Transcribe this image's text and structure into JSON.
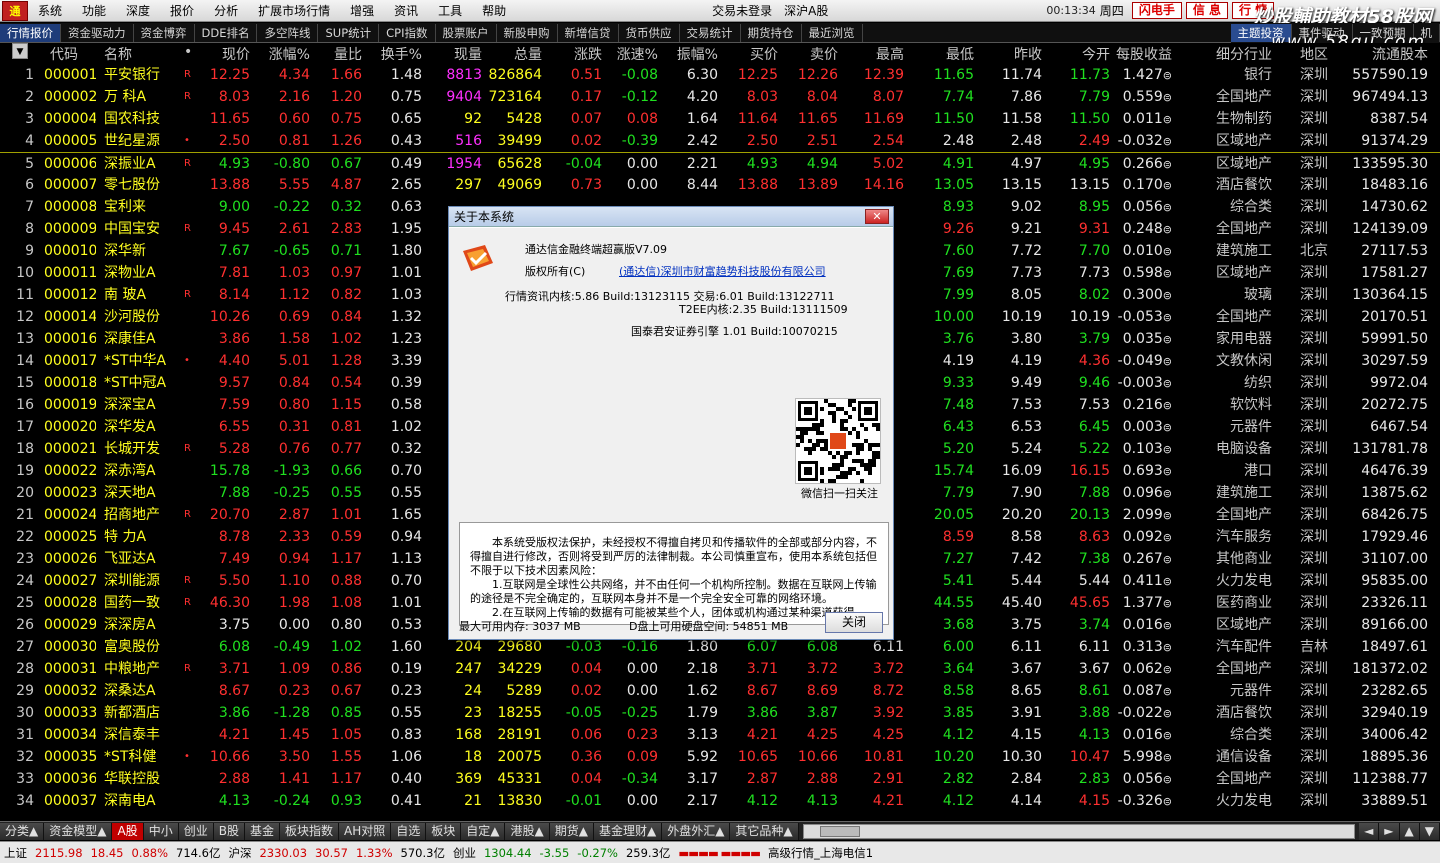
{
  "menubar": {
    "items": [
      "系统",
      "功能",
      "深度",
      "报价",
      "分析",
      "扩展市场行情",
      "增强",
      "资讯",
      "工具",
      "帮助"
    ],
    "login_status": "交易未登录",
    "market": "深沪A股",
    "clock": "00:13:34",
    "weekday": "周四",
    "buttons": [
      "闪电手",
      "信 息",
      "行 情"
    ]
  },
  "watermark": {
    "line1": "炒股輔助教材58股网",
    "line2": "www.58gu.com"
  },
  "tabs": [
    "行情报价",
    "资金驱动力",
    "资金博弈",
    "DDE排名",
    "多空阵线",
    "SUP统计",
    "CPI指数",
    "股票账户",
    "新股申购",
    "新增信贷",
    "货币供应",
    "交易统计",
    "期货持仓",
    "最近浏览"
  ],
  "tabs_right": [
    "主题投资",
    "事件驱动",
    "一致预期",
    "机"
  ],
  "columns": [
    "代码",
    "名称",
    "•",
    "现价",
    "涨幅%",
    "量比",
    "换手%",
    "现量",
    "总量",
    "涨跌",
    "涨速%",
    "振幅%",
    "买价",
    "卖价",
    "最高",
    "最低",
    "昨收",
    "今开",
    "每股收益",
    "细分行业",
    "地区",
    "流通股本"
  ],
  "rows": [
    [
      "1",
      "000001",
      "平安银行",
      "R",
      "12.25",
      "4.34",
      "1.66",
      "1.48",
      "8813",
      "826864",
      "0.51",
      "-0.08",
      "6.30",
      "12.25",
      "12.26",
      "12.39",
      "11.65",
      "11.74",
      "11.73",
      "1.427",
      "银行",
      "深圳",
      "557590.19"
    ],
    [
      "2",
      "000002",
      "万  科A",
      "R",
      "8.03",
      "2.16",
      "1.20",
      "0.75",
      "9404",
      "723164",
      "0.17",
      "-0.12",
      "4.20",
      "8.03",
      "8.04",
      "8.07",
      "7.74",
      "7.86",
      "7.79",
      "0.559",
      "全国地产",
      "深圳",
      "967494.13"
    ],
    [
      "3",
      "000004",
      "国农科技",
      "",
      "11.65",
      "0.60",
      "0.75",
      "0.65",
      "92",
      "5428",
      "0.07",
      "0.08",
      "1.64",
      "11.64",
      "11.65",
      "11.69",
      "11.50",
      "11.58",
      "11.50",
      "0.011",
      "生物制药",
      "深圳",
      "8387.54"
    ],
    [
      "4",
      "000005",
      "世纪星源",
      "•",
      "2.50",
      "0.81",
      "1.26",
      "0.43",
      "516",
      "39499",
      "0.02",
      "-0.39",
      "2.42",
      "2.50",
      "2.51",
      "2.54",
      "2.48",
      "2.48",
      "2.49",
      "-0.032",
      "区域地产",
      "深圳",
      "91374.29"
    ],
    [
      "5",
      "000006",
      "深振业A",
      "R",
      "4.93",
      "-0.80",
      "0.67",
      "0.49",
      "1954",
      "65628",
      "-0.04",
      "0.00",
      "2.21",
      "4.93",
      "4.94",
      "5.02",
      "4.91",
      "4.97",
      "4.95",
      "0.266",
      "区域地产",
      "深圳",
      "133595.30"
    ],
    [
      "6",
      "000007",
      "零七股份",
      "",
      "13.88",
      "5.55",
      "4.87",
      "2.65",
      "297",
      "49069",
      "0.73",
      "0.00",
      "8.44",
      "13.88",
      "13.89",
      "14.16",
      "13.05",
      "13.15",
      "13.15",
      "0.170",
      "酒店餐饮",
      "深圳",
      "18483.16"
    ],
    [
      "7",
      "000008",
      "宝利来",
      "",
      "9.00",
      "-0.22",
      "0.32",
      "0.63",
      "",
      "",
      "",
      "",
      "",
      "",
      "",
      "",
      "8.93",
      "9.02",
      "8.95",
      "0.056",
      "综合类",
      "深圳",
      "14730.62"
    ],
    [
      "8",
      "000009",
      "中国宝安",
      "R",
      "9.45",
      "2.61",
      "2.83",
      "1.95",
      "",
      "",
      "",
      "",
      "",
      "",
      "",
      "",
      "9.26",
      "9.21",
      "9.31",
      "0.248",
      "全国地产",
      "深圳",
      "124139.09"
    ],
    [
      "9",
      "000010",
      "深华新",
      "",
      "7.67",
      "-0.65",
      "0.71",
      "1.80",
      "",
      "",
      "",
      "",
      "",
      "",
      "",
      "",
      "7.60",
      "7.72",
      "7.70",
      "0.010",
      "建筑施工",
      "北京",
      "27117.53"
    ],
    [
      "10",
      "000011",
      "深物业A",
      "",
      "7.81",
      "1.03",
      "0.97",
      "1.01",
      "",
      "",
      "",
      "",
      "",
      "",
      "",
      "",
      "7.69",
      "7.73",
      "7.73",
      "0.598",
      "区域地产",
      "深圳",
      "17581.27"
    ],
    [
      "11",
      "000012",
      "南  玻A",
      "R",
      "8.14",
      "1.12",
      "0.82",
      "1.03",
      "",
      "",
      "",
      "",
      "",
      "",
      "",
      "",
      "7.99",
      "8.05",
      "8.02",
      "0.300",
      "玻璃",
      "深圳",
      "130364.15"
    ],
    [
      "12",
      "000014",
      "沙河股份",
      "",
      "10.26",
      "0.69",
      "0.84",
      "1.32",
      "",
      "",
      "",
      "",
      "",
      "",
      "",
      "",
      "10.00",
      "10.19",
      "10.19",
      "-0.053",
      "全国地产",
      "深圳",
      "20170.51"
    ],
    [
      "13",
      "000016",
      "深康佳A",
      "",
      "3.86",
      "1.58",
      "1.02",
      "1.23",
      "",
      "",
      "",
      "",
      "",
      "",
      "",
      "",
      "3.76",
      "3.80",
      "3.79",
      "0.035",
      "家用电器",
      "深圳",
      "59991.50"
    ],
    [
      "14",
      "000017",
      "*ST中华A",
      "•",
      "4.40",
      "5.01",
      "1.28",
      "3.39",
      "",
      "",
      "",
      "",
      "",
      "",
      "",
      "",
      "4.19",
      "4.19",
      "4.36",
      "-0.049",
      "文教休闲",
      "深圳",
      "30297.59"
    ],
    [
      "15",
      "000018",
      "*ST中冠A",
      "",
      "9.57",
      "0.84",
      "0.54",
      "0.39",
      "",
      "",
      "",
      "",
      "",
      "",
      "",
      "",
      "9.33",
      "9.49",
      "9.46",
      "-0.003",
      "纺织",
      "深圳",
      "9972.04"
    ],
    [
      "16",
      "000019",
      "深深宝A",
      "",
      "7.59",
      "0.80",
      "1.15",
      "0.58",
      "",
      "",
      "",
      "",
      "",
      "",
      "",
      "",
      "7.48",
      "7.53",
      "7.53",
      "0.216",
      "软饮料",
      "深圳",
      "20272.75"
    ],
    [
      "17",
      "000020",
      "深华发A",
      "",
      "6.55",
      "0.31",
      "0.81",
      "1.02",
      "",
      "",
      "",
      "",
      "",
      "",
      "",
      "",
      "6.43",
      "6.53",
      "6.45",
      "0.003",
      "元器件",
      "深圳",
      "6467.54"
    ],
    [
      "18",
      "000021",
      "长城开发",
      "R",
      "5.28",
      "0.76",
      "0.77",
      "0.32",
      "",
      "",
      "",
      "",
      "",
      "",
      "",
      "",
      "5.20",
      "5.24",
      "5.22",
      "0.103",
      "电脑设备",
      "深圳",
      "131781.78"
    ],
    [
      "19",
      "000022",
      "深赤湾A",
      "",
      "15.78",
      "-1.93",
      "0.66",
      "0.70",
      "",
      "",
      "",
      "",
      "",
      "",
      "",
      "",
      "15.74",
      "16.09",
      "16.15",
      "0.693",
      "港口",
      "深圳",
      "46476.39"
    ],
    [
      "20",
      "000023",
      "深天地A",
      "",
      "7.88",
      "-0.25",
      "0.55",
      "0.55",
      "",
      "",
      "",
      "",
      "",
      "",
      "",
      "",
      "7.79",
      "7.90",
      "7.88",
      "0.096",
      "建筑施工",
      "深圳",
      "13875.62"
    ],
    [
      "21",
      "000024",
      "招商地产",
      "R",
      "20.70",
      "2.87",
      "1.01",
      "1.65",
      "",
      "",
      "",
      "",
      "",
      "",
      "",
      "",
      "20.05",
      "20.20",
      "20.13",
      "2.099",
      "全国地产",
      "深圳",
      "68426.75"
    ],
    [
      "22",
      "000025",
      "特  力A",
      "",
      "8.78",
      "2.33",
      "0.59",
      "0.94",
      "",
      "",
      "",
      "",
      "",
      "",
      "",
      "",
      "8.59",
      "8.58",
      "8.63",
      "0.092",
      "汽车服务",
      "深圳",
      "17929.46"
    ],
    [
      "23",
      "000026",
      "飞亚达A",
      "",
      "7.49",
      "0.94",
      "1.17",
      "1.13",
      "",
      "",
      "",
      "",
      "",
      "",
      "",
      "",
      "7.27",
      "7.42",
      "7.38",
      "0.267",
      "其他商业",
      "深圳",
      "31107.00"
    ],
    [
      "24",
      "000027",
      "深圳能源",
      "R",
      "5.50",
      "1.10",
      "0.88",
      "0.70",
      "",
      "",
      "",
      "",
      "",
      "",
      "",
      "",
      "5.41",
      "5.44",
      "5.44",
      "0.411",
      "火力发电",
      "深圳",
      "95835.00"
    ],
    [
      "25",
      "000028",
      "国药一致",
      "R",
      "46.30",
      "1.98",
      "1.08",
      "1.01",
      "",
      "",
      "",
      "",
      "",
      "",
      "",
      "",
      "44.55",
      "45.40",
      "45.65",
      "1.377",
      "医药商业",
      "深圳",
      "23326.11"
    ],
    [
      "26",
      "000029",
      "深深房A",
      "",
      "3.75",
      "0.00",
      "0.80",
      "0.53",
      "",
      "",
      "",
      "",
      "",
      "",
      "",
      "",
      "3.68",
      "3.75",
      "3.74",
      "0.016",
      "区域地产",
      "深圳",
      "89166.00"
    ],
    [
      "27",
      "000030",
      "富奥股份",
      "",
      "6.08",
      "-0.49",
      "1.02",
      "1.60",
      "204",
      "29680",
      "-0.03",
      "-0.16",
      "1.80",
      "6.07",
      "6.08",
      "6.11",
      "6.00",
      "6.11",
      "6.11",
      "0.313",
      "汽车配件",
      "吉林",
      "18497.61"
    ],
    [
      "28",
      "000031",
      "中粮地产",
      "R",
      "3.71",
      "1.09",
      "0.86",
      "0.19",
      "247",
      "34229",
      "0.04",
      "0.00",
      "2.18",
      "3.71",
      "3.72",
      "3.72",
      "3.64",
      "3.67",
      "3.67",
      "0.062",
      "全国地产",
      "深圳",
      "181372.02"
    ],
    [
      "29",
      "000032",
      "深桑达A",
      "",
      "8.67",
      "0.23",
      "0.67",
      "0.23",
      "24",
      "5289",
      "0.02",
      "0.00",
      "1.62",
      "8.67",
      "8.69",
      "8.72",
      "8.58",
      "8.65",
      "8.61",
      "0.087",
      "元器件",
      "深圳",
      "23282.65"
    ],
    [
      "30",
      "000033",
      "新都酒店",
      "",
      "3.86",
      "-1.28",
      "0.85",
      "0.55",
      "23",
      "18255",
      "-0.05",
      "-0.25",
      "1.79",
      "3.86",
      "3.87",
      "3.92",
      "3.85",
      "3.91",
      "3.88",
      "-0.022",
      "酒店餐饮",
      "深圳",
      "32940.19"
    ],
    [
      "31",
      "000034",
      "深信泰丰",
      "",
      "4.21",
      "1.45",
      "1.05",
      "0.83",
      "168",
      "28191",
      "0.06",
      "0.23",
      "3.13",
      "4.21",
      "4.25",
      "4.25",
      "4.12",
      "4.15",
      "4.13",
      "0.016",
      "综合类",
      "深圳",
      "34006.42"
    ],
    [
      "32",
      "000035",
      "*ST科健",
      "•",
      "10.66",
      "3.50",
      "1.55",
      "1.06",
      "18",
      "20075",
      "0.36",
      "0.09",
      "5.92",
      "10.65",
      "10.66",
      "10.81",
      "10.20",
      "10.30",
      "10.47",
      "5.998",
      "通信设备",
      "深圳",
      "18895.36"
    ],
    [
      "33",
      "000036",
      "华联控股",
      "",
      "2.88",
      "1.41",
      "1.17",
      "0.40",
      "369",
      "45331",
      "0.04",
      "-0.34",
      "3.17",
      "2.87",
      "2.88",
      "2.91",
      "2.82",
      "2.84",
      "2.83",
      "0.056",
      "全国地产",
      "深圳",
      "112388.77"
    ],
    [
      "34",
      "000037",
      "深南电A",
      "",
      "4.13",
      "-0.24",
      "0.93",
      "0.41",
      "21",
      "13830",
      "-0.01",
      "0.00",
      "2.17",
      "4.12",
      "4.13",
      "4.21",
      "4.12",
      "4.14",
      "4.15",
      "-0.326",
      "火力发电",
      "深圳",
      "33889.51"
    ]
  ],
  "bottom_tabs": [
    "分类▲",
    "资金模型▲",
    "A股",
    "中小",
    "创业",
    "B股",
    "基金",
    "板块指数",
    "AH对照",
    "自选",
    "板块",
    "自定▲",
    "港股▲",
    "期货▲",
    "基金理财▲",
    "外盘外汇▲",
    "其它品种▲"
  ],
  "statusbar": {
    "sh_label": "上证",
    "sh_index": "2115.98",
    "sh_change": "18.45",
    "sh_pct": "0.88%",
    "sh_amount": "714.6亿",
    "sz_label": "沪深",
    "sz_index": "2330.03",
    "sz_change": "30.57",
    "sz_pct": "1.33%",
    "sz_amount": "570.3亿",
    "cy_label": "创业",
    "cy_index": "1304.44",
    "cy_change": "-3.55",
    "cy_pct": "-0.27%",
    "cy_amount": "259.3亿",
    "server": "高级行情_上海电信1"
  },
  "dialog": {
    "title": "关于本系统",
    "product": "通达信金融终端超赢版V7.09",
    "copyright_label": "版权所有(C)",
    "company": "(通达信)深圳市财富趋势科技股份有限公司",
    "kernel": "行情资讯内核:5.86 Build:13123115  交易:6.01 Build:13122711",
    "t2ee": "T2EE内核:2.35 Build:13111509",
    "engine": "国泰君安证券引擎 1.01 Build:10070215",
    "qr_caption": "微信扫一扫关注",
    "notice": [
      "本系统受版权法保护，未经授权不得擅自拷贝和传播软件的全部或部分内容，不得擅自进行修改，否则将受到严厉的法律制裁。本公司慎重宣布，使用本系统包括但不限于以下技术因素风险：",
      "1.互联网是全球性公共网络，并不由任何一个机构所控制。数据在互联网上传输的途径是不完全确定的，互联网本身并不是一个完全安全可靠的网络环境。",
      "2.在互联网上传输的数据有可能被某些个人，团体或机构通过某种渠道获得"
    ],
    "memory": "最大可用内存: 3037 MB",
    "disk": "D盘上可用硬盘空间: 54851 MB",
    "close": "关闭"
  }
}
